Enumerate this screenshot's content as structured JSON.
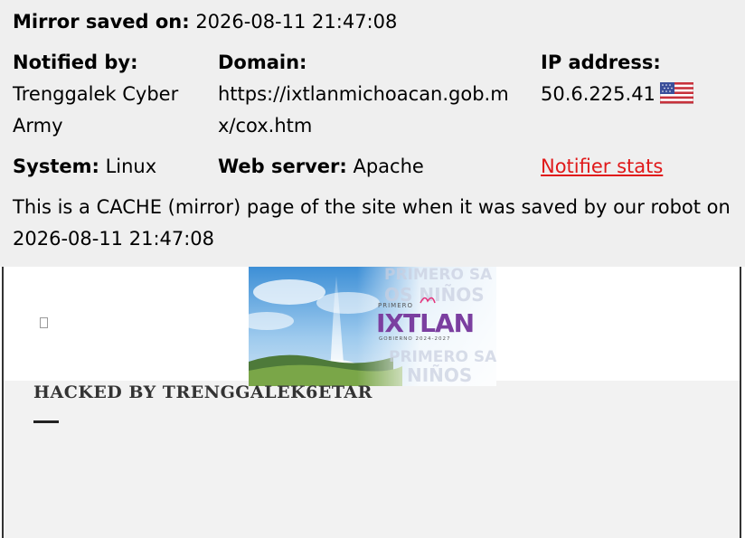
{
  "header": {
    "saved_label": "Mirror saved on:",
    "saved_value": "2026-08-11 21:47:08",
    "notified_label": "Notified by:",
    "notified_value": "Trenggalek Cyber Army",
    "domain_label": "Domain:",
    "domain_value": "https://ixtlanmichoacan.gob.mx/cox.htm",
    "ip_label": "IP address:",
    "ip_value": "50.6.225.41",
    "ip_flag": "us-flag-icon",
    "system_label": "System:",
    "system_value": "Linux",
    "webserver_label": "Web server:",
    "webserver_value": "Apache",
    "stats_link": "Notifier stats",
    "cache_note": "This is a CACHE (mirror) page of the site when it was saved by our robot on 2026-08-11 21:47:08"
  },
  "mirror": {
    "banner": {
      "word1": "PRIMERO",
      "logo_text": "IXTLAN",
      "subtitle": "GOBIERNO 2024-2027",
      "bg_text1": "PRIMERO SA",
      "bg_text2": "OS NIÑOS",
      "bg_text3": "PRIMERO SALU",
      "bg_text4": "NIÑOS"
    },
    "title": "HACKED BY TRENGGALEK6ETAR"
  },
  "colors": {
    "header_bg": "#efefef",
    "link": "#e0191a",
    "logo_purple": "#7b3fa0",
    "logo_orange": "#f39a1b",
    "logo_green": "#3fae49",
    "logo_pink": "#e5307a"
  }
}
